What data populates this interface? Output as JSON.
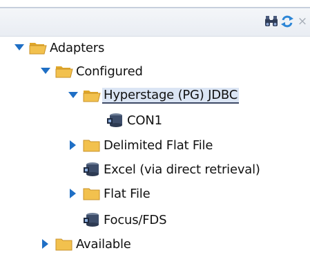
{
  "toolbar": {
    "icons": [
      "binoculars-icon",
      "refresh-icon",
      "close-icon"
    ],
    "close_glyph": "×"
  },
  "tree": {
    "adapters": "Adapters",
    "configured": "Configured",
    "hyperstage": "Hyperstage (PG) JDBC",
    "con1": "CON1",
    "delimited_flat_file": "Delimited Flat File",
    "excel": "Excel (via direct retrieval)",
    "flat_file": "Flat File",
    "focus_fds": "Focus/FDS",
    "available": "Available"
  },
  "colors": {
    "folder": "#f2c14e",
    "arrow": "#1f6fc5",
    "selected_bg": "#dbe5f4"
  }
}
